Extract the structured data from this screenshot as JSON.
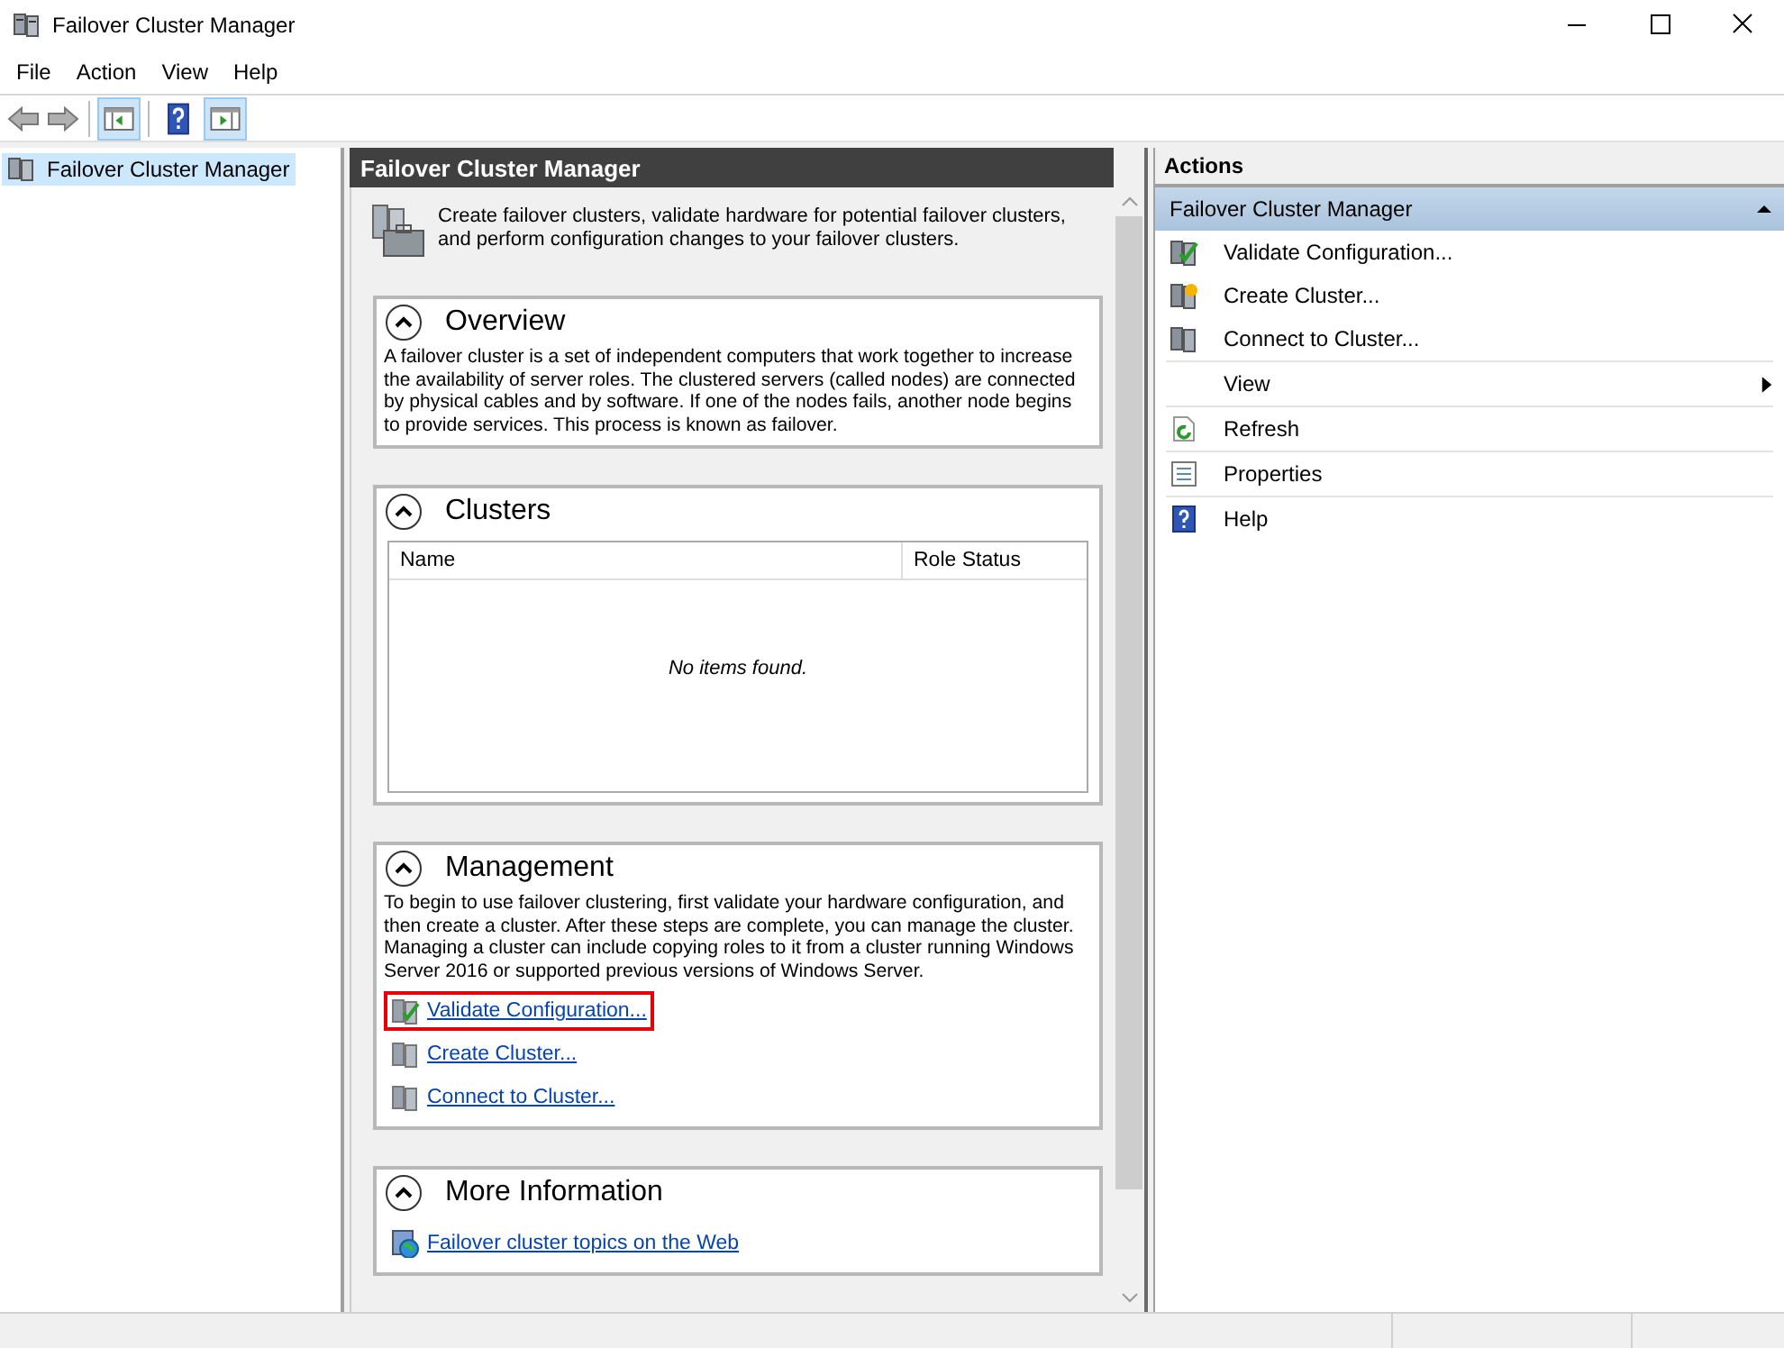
{
  "window": {
    "title": "Failover Cluster Manager"
  },
  "menu": [
    "File",
    "Action",
    "View",
    "Help"
  ],
  "toolbar": [
    {
      "kind": "back",
      "disabled": true
    },
    {
      "kind": "forward",
      "disabled": true
    },
    {
      "kind": "tree",
      "pressed": true
    },
    {
      "kind": "help",
      "pressed": false
    },
    {
      "kind": "actionpane",
      "pressed": true
    }
  ],
  "tree": {
    "items": [
      {
        "label": "Failover Cluster Manager",
        "selected": true
      }
    ]
  },
  "main": {
    "title": "Failover Cluster Manager",
    "intro": "Create failover clusters, validate hardware for potential failover clusters, and perform configuration changes to your failover clusters.",
    "sections": [
      {
        "kind": "text",
        "title": "Overview",
        "expanded": true,
        "text": "A failover cluster is a set of independent computers that work together to increase the availability of server roles. The clustered servers (called nodes) are connected by physical cables and by software. If one of the nodes fails, another node begins to provide services. This process is known as failover."
      },
      {
        "kind": "table",
        "title": "Clusters",
        "expanded": true,
        "columns": [
          "Name",
          "Role Status"
        ],
        "empty_text": "No items found."
      },
      {
        "kind": "links",
        "title": "Management",
        "expanded": true,
        "text": "To begin to use failover clustering, first validate your hardware configuration, and then create a cluster.  After these steps are complete, you can manage the cluster. Managing a cluster can include copying roles to it from a cluster running Windows Server 2016 or supported previous versions of Windows Server.",
        "links": [
          {
            "label": "Validate Configuration...",
            "kind": "validate",
            "highlighted": true
          },
          {
            "label": "Create Cluster...",
            "kind": "create",
            "highlighted": false
          },
          {
            "label": "Connect to Cluster...",
            "kind": "connect",
            "highlighted": false
          }
        ]
      },
      {
        "kind": "links",
        "title": "More Information",
        "expanded": true,
        "links": [
          {
            "label": "Failover cluster topics on the Web",
            "kind": "web",
            "highlighted": false
          }
        ]
      }
    ]
  },
  "actions": {
    "title": "Actions",
    "group": {
      "title": "Failover Cluster Manager",
      "expanded": true
    },
    "items": [
      {
        "label": "Validate Configuration...",
        "kind": "validate"
      },
      {
        "label": "Create Cluster...",
        "kind": "create"
      },
      {
        "label": "Connect to Cluster...",
        "kind": "connect"
      },
      {
        "label": "View",
        "kind": "submenu"
      },
      {
        "label": "Refresh",
        "kind": "refresh"
      },
      {
        "label": "Properties",
        "kind": "properties"
      },
      {
        "label": "Help",
        "kind": "help"
      }
    ]
  }
}
